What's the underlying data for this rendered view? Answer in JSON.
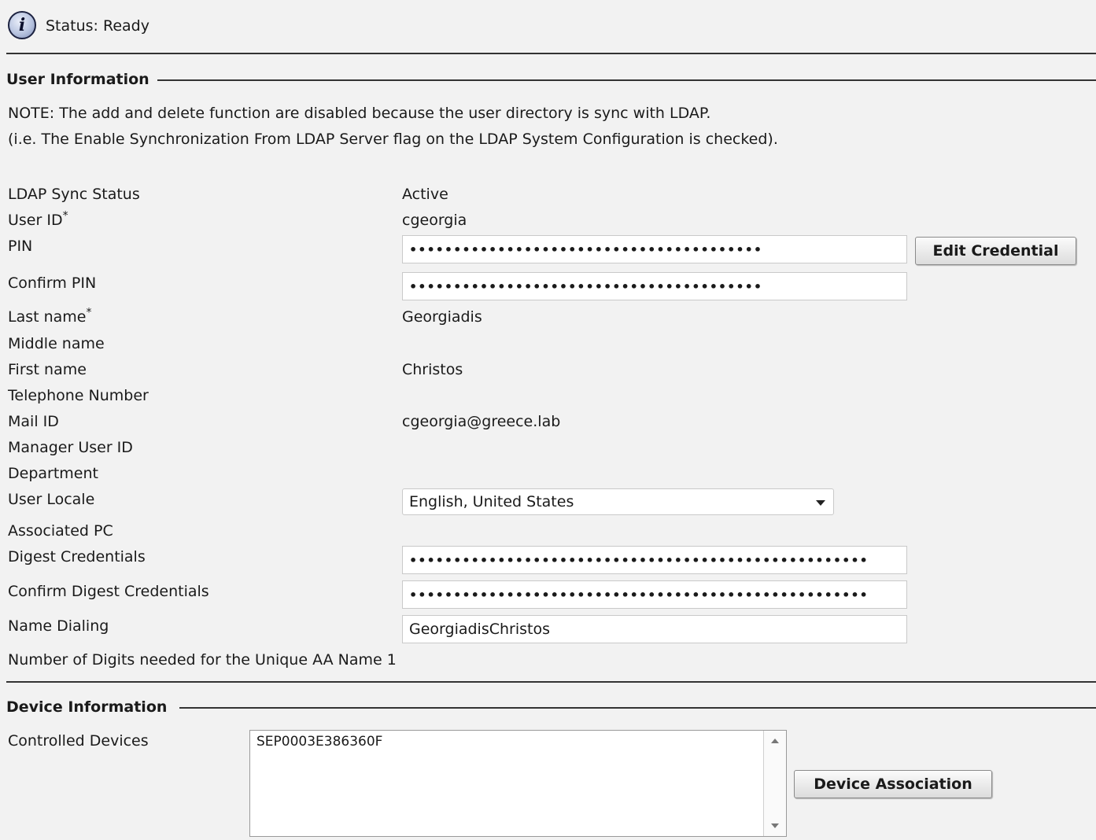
{
  "status": {
    "icon": "info-icon",
    "icon_glyph": "i",
    "text": "Status: Ready"
  },
  "user_info": {
    "title": "User Information",
    "note_line1": "NOTE: The add and delete function are disabled because the user directory is sync with LDAP.",
    "note_line2": "(i.e. The Enable Synchronization From LDAP Server flag on the LDAP System Configuration is checked).",
    "ldap_sync_status": {
      "label": "LDAP Sync Status",
      "value": "Active"
    },
    "user_id": {
      "label": "User ID",
      "required_mark": "*",
      "value": "cgeorgia"
    },
    "pin": {
      "label": "PIN",
      "value": "••••••••••••••••••••••••••••••••••••••••"
    },
    "confirm_pin": {
      "label": "Confirm PIN",
      "value": "••••••••••••••••••••••••••••••••••••••••"
    },
    "edit_credential_label": "Edit Credential",
    "last_name": {
      "label": "Last name",
      "required_mark": "*",
      "value": "Georgiadis"
    },
    "middle_name": {
      "label": "Middle name",
      "value": ""
    },
    "first_name": {
      "label": "First name",
      "value": "Christos"
    },
    "telephone_number": {
      "label": "Telephone Number",
      "value": ""
    },
    "mail_id": {
      "label": "Mail ID",
      "value": "cgeorgia@greece.lab"
    },
    "manager_user_id": {
      "label": "Manager User ID",
      "value": ""
    },
    "department": {
      "label": "Department",
      "value": ""
    },
    "user_locale": {
      "label": "User Locale",
      "selected": "English, United States"
    },
    "associated_pc": {
      "label": "Associated PC",
      "value": ""
    },
    "digest_credentials": {
      "label": "Digest Credentials",
      "value": "••••••••••••••••••••••••••••••••••••••••••••••••••••"
    },
    "confirm_digest_credentials": {
      "label": "Confirm Digest Credentials",
      "value": "••••••••••••••••••••••••••••••••••••••••••••••••••••"
    },
    "name_dialing": {
      "label": "Name Dialing",
      "value": "GeorgiadisChristos"
    },
    "unique_aa_digits": {
      "label": "Number of Digits needed for the Unique AA Name",
      "value": "1"
    }
  },
  "device_info": {
    "title": "Device Information",
    "controlled_devices": {
      "label": "Controlled Devices",
      "items": [
        "SEP0003E386360F"
      ]
    },
    "device_association_label": "Device Association"
  }
}
